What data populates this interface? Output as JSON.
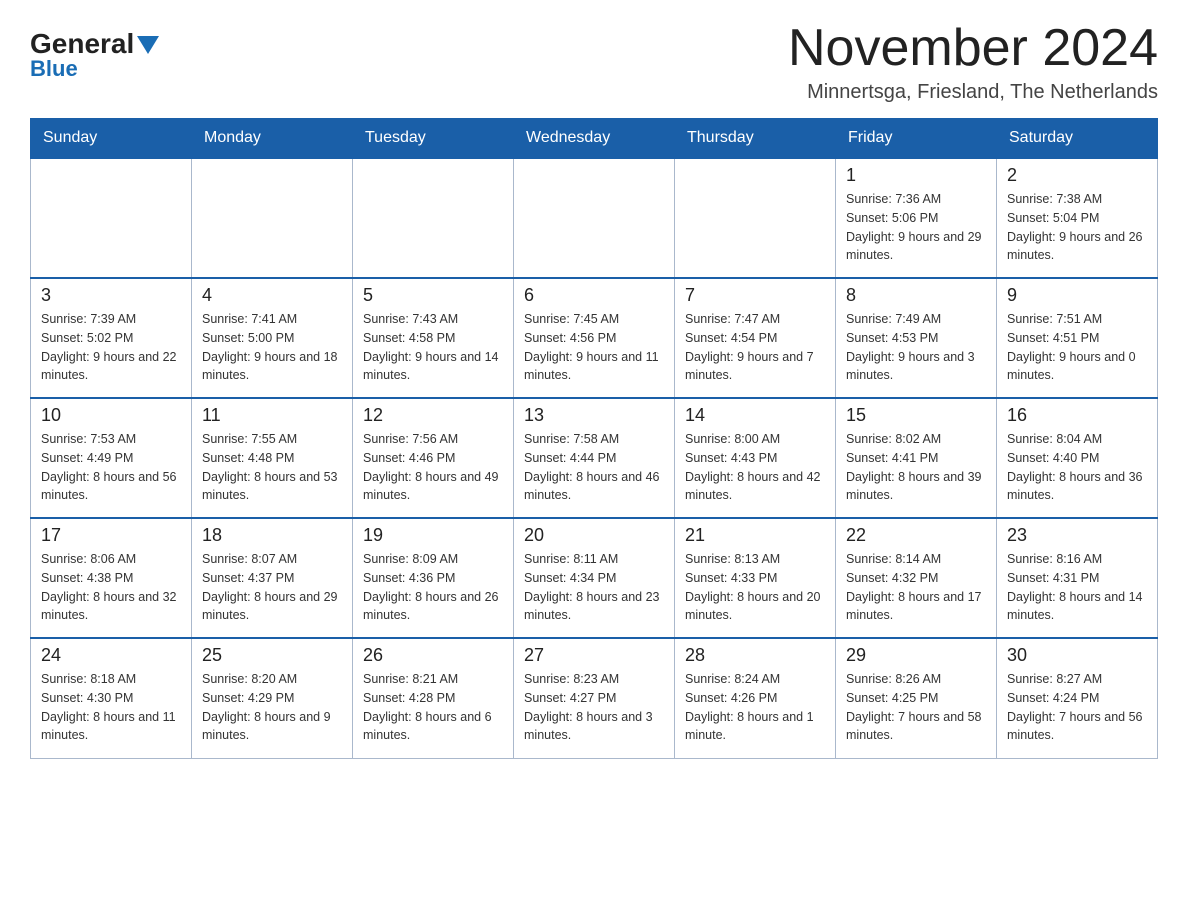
{
  "logo": {
    "brand": "General",
    "accent": "Blue"
  },
  "header": {
    "month_year": "November 2024",
    "location": "Minnertsga, Friesland, The Netherlands"
  },
  "days_of_week": [
    "Sunday",
    "Monday",
    "Tuesday",
    "Wednesday",
    "Thursday",
    "Friday",
    "Saturday"
  ],
  "weeks": [
    [
      {
        "day": "",
        "info": ""
      },
      {
        "day": "",
        "info": ""
      },
      {
        "day": "",
        "info": ""
      },
      {
        "day": "",
        "info": ""
      },
      {
        "day": "",
        "info": ""
      },
      {
        "day": "1",
        "info": "Sunrise: 7:36 AM\nSunset: 5:06 PM\nDaylight: 9 hours and 29 minutes."
      },
      {
        "day": "2",
        "info": "Sunrise: 7:38 AM\nSunset: 5:04 PM\nDaylight: 9 hours and 26 minutes."
      }
    ],
    [
      {
        "day": "3",
        "info": "Sunrise: 7:39 AM\nSunset: 5:02 PM\nDaylight: 9 hours and 22 minutes."
      },
      {
        "day": "4",
        "info": "Sunrise: 7:41 AM\nSunset: 5:00 PM\nDaylight: 9 hours and 18 minutes."
      },
      {
        "day": "5",
        "info": "Sunrise: 7:43 AM\nSunset: 4:58 PM\nDaylight: 9 hours and 14 minutes."
      },
      {
        "day": "6",
        "info": "Sunrise: 7:45 AM\nSunset: 4:56 PM\nDaylight: 9 hours and 11 minutes."
      },
      {
        "day": "7",
        "info": "Sunrise: 7:47 AM\nSunset: 4:54 PM\nDaylight: 9 hours and 7 minutes."
      },
      {
        "day": "8",
        "info": "Sunrise: 7:49 AM\nSunset: 4:53 PM\nDaylight: 9 hours and 3 minutes."
      },
      {
        "day": "9",
        "info": "Sunrise: 7:51 AM\nSunset: 4:51 PM\nDaylight: 9 hours and 0 minutes."
      }
    ],
    [
      {
        "day": "10",
        "info": "Sunrise: 7:53 AM\nSunset: 4:49 PM\nDaylight: 8 hours and 56 minutes."
      },
      {
        "day": "11",
        "info": "Sunrise: 7:55 AM\nSunset: 4:48 PM\nDaylight: 8 hours and 53 minutes."
      },
      {
        "day": "12",
        "info": "Sunrise: 7:56 AM\nSunset: 4:46 PM\nDaylight: 8 hours and 49 minutes."
      },
      {
        "day": "13",
        "info": "Sunrise: 7:58 AM\nSunset: 4:44 PM\nDaylight: 8 hours and 46 minutes."
      },
      {
        "day": "14",
        "info": "Sunrise: 8:00 AM\nSunset: 4:43 PM\nDaylight: 8 hours and 42 minutes."
      },
      {
        "day": "15",
        "info": "Sunrise: 8:02 AM\nSunset: 4:41 PM\nDaylight: 8 hours and 39 minutes."
      },
      {
        "day": "16",
        "info": "Sunrise: 8:04 AM\nSunset: 4:40 PM\nDaylight: 8 hours and 36 minutes."
      }
    ],
    [
      {
        "day": "17",
        "info": "Sunrise: 8:06 AM\nSunset: 4:38 PM\nDaylight: 8 hours and 32 minutes."
      },
      {
        "day": "18",
        "info": "Sunrise: 8:07 AM\nSunset: 4:37 PM\nDaylight: 8 hours and 29 minutes."
      },
      {
        "day": "19",
        "info": "Sunrise: 8:09 AM\nSunset: 4:36 PM\nDaylight: 8 hours and 26 minutes."
      },
      {
        "day": "20",
        "info": "Sunrise: 8:11 AM\nSunset: 4:34 PM\nDaylight: 8 hours and 23 minutes."
      },
      {
        "day": "21",
        "info": "Sunrise: 8:13 AM\nSunset: 4:33 PM\nDaylight: 8 hours and 20 minutes."
      },
      {
        "day": "22",
        "info": "Sunrise: 8:14 AM\nSunset: 4:32 PM\nDaylight: 8 hours and 17 minutes."
      },
      {
        "day": "23",
        "info": "Sunrise: 8:16 AM\nSunset: 4:31 PM\nDaylight: 8 hours and 14 minutes."
      }
    ],
    [
      {
        "day": "24",
        "info": "Sunrise: 8:18 AM\nSunset: 4:30 PM\nDaylight: 8 hours and 11 minutes."
      },
      {
        "day": "25",
        "info": "Sunrise: 8:20 AM\nSunset: 4:29 PM\nDaylight: 8 hours and 9 minutes."
      },
      {
        "day": "26",
        "info": "Sunrise: 8:21 AM\nSunset: 4:28 PM\nDaylight: 8 hours and 6 minutes."
      },
      {
        "day": "27",
        "info": "Sunrise: 8:23 AM\nSunset: 4:27 PM\nDaylight: 8 hours and 3 minutes."
      },
      {
        "day": "28",
        "info": "Sunrise: 8:24 AM\nSunset: 4:26 PM\nDaylight: 8 hours and 1 minute."
      },
      {
        "day": "29",
        "info": "Sunrise: 8:26 AM\nSunset: 4:25 PM\nDaylight: 7 hours and 58 minutes."
      },
      {
        "day": "30",
        "info": "Sunrise: 8:27 AM\nSunset: 4:24 PM\nDaylight: 7 hours and 56 minutes."
      }
    ]
  ]
}
